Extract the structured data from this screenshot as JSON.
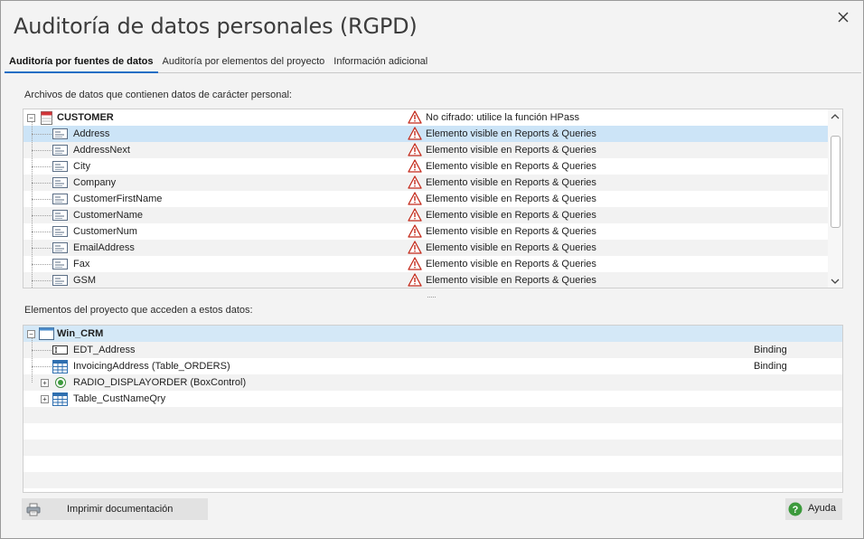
{
  "window": {
    "title": "Auditoría de datos personales (RGPD)",
    "close_icon": "close-icon"
  },
  "tabs": [
    {
      "label": "Auditoría por fuentes de datos",
      "active": true
    },
    {
      "label": "Auditoría por elementos del proyecto",
      "active": false
    },
    {
      "label": "Información adicional",
      "active": false
    }
  ],
  "datafiles": {
    "label": "Archivos de datos que contienen datos de carácter personal:",
    "root": {
      "name": "CUSTOMER",
      "warning": "No cifrado: utilice la función HPass",
      "icon": "table-file-icon",
      "expanded": true
    },
    "items": [
      {
        "name": "Address",
        "warning": "Elemento visible en Reports & Queries",
        "selected": true
      },
      {
        "name": "AddressNext",
        "warning": "Elemento visible en Reports & Queries"
      },
      {
        "name": "City",
        "warning": "Elemento visible en Reports & Queries"
      },
      {
        "name": "Company",
        "warning": "Elemento visible en Reports & Queries"
      },
      {
        "name": "CustomerFirstName",
        "warning": "Elemento visible en Reports & Queries"
      },
      {
        "name": "CustomerName",
        "warning": "Elemento visible en Reports & Queries"
      },
      {
        "name": "CustomerNum",
        "warning": "Elemento visible en Reports & Queries"
      },
      {
        "name": "EmailAddress",
        "warning": "Elemento visible en Reports & Queries"
      },
      {
        "name": "Fax",
        "warning": "Elemento visible en Reports & Queries"
      },
      {
        "name": "GSM",
        "warning": "Elemento visible en Reports & Queries"
      }
    ],
    "item_icon": "field-icon",
    "warning_icon": "warning-icon"
  },
  "project": {
    "label": "Elementos del proyecto que acceden a estos datos:",
    "root": {
      "name": "Win_CRM",
      "icon": "window-icon",
      "expanded": true
    },
    "items": [
      {
        "name": "EDT_Address",
        "info": "Binding",
        "icon": "edit-control-icon",
        "expandable": false
      },
      {
        "name": "InvoicingAddress (Table_ORDERS)",
        "info": "Binding",
        "icon": "table-icon",
        "expandable": false
      },
      {
        "name": "RADIO_DISPLAYORDER (BoxControl)",
        "info": "",
        "icon": "radio-icon",
        "expandable": true
      },
      {
        "name": "Table_CustNameQry",
        "info": "",
        "icon": "table-icon",
        "expandable": true
      }
    ]
  },
  "footer": {
    "print_label": "Imprimir documentación",
    "help_label": "Ayuda"
  },
  "colors": {
    "accent": "#1f6fc5",
    "selection": "#cce4f7",
    "header_row": "#d4e8f7",
    "warning_red": "#c42b1c",
    "help_green": "#3c9a3c"
  }
}
